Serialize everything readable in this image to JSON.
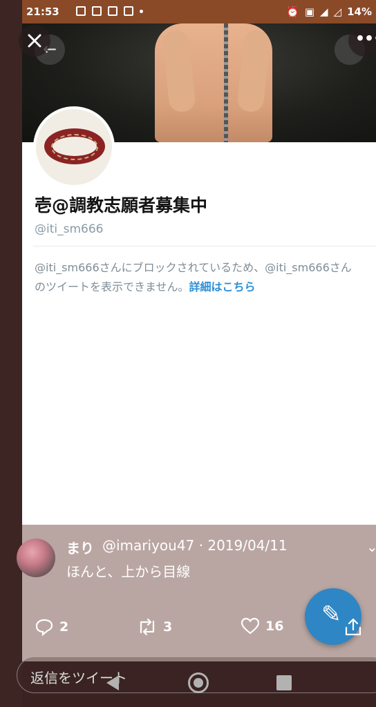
{
  "status_bar": {
    "time": "21:53",
    "battery": "14%"
  },
  "profile": {
    "name": "壱@調教志願者募集中",
    "handle": "@iti_sm666",
    "blocked_message": "@iti_sm666さんにブロックされているため、@iti_sm666さんのツイートを表示できません。",
    "blocked_link": "詳細はこちら"
  },
  "tweet": {
    "author_name": "まり",
    "meta": "@imariyou47 · 2019/04/11",
    "text": "ほんと、上から目線",
    "reply_count": "2",
    "retweet_count": "3",
    "like_count": "16"
  },
  "reply_input": {
    "placeholder": "返信をツイート"
  },
  "colors": {
    "status_bar": "#8a4a28",
    "accent": "#2f86c4",
    "link": "#2d8fd6",
    "overlay": "#b9a6a2"
  }
}
